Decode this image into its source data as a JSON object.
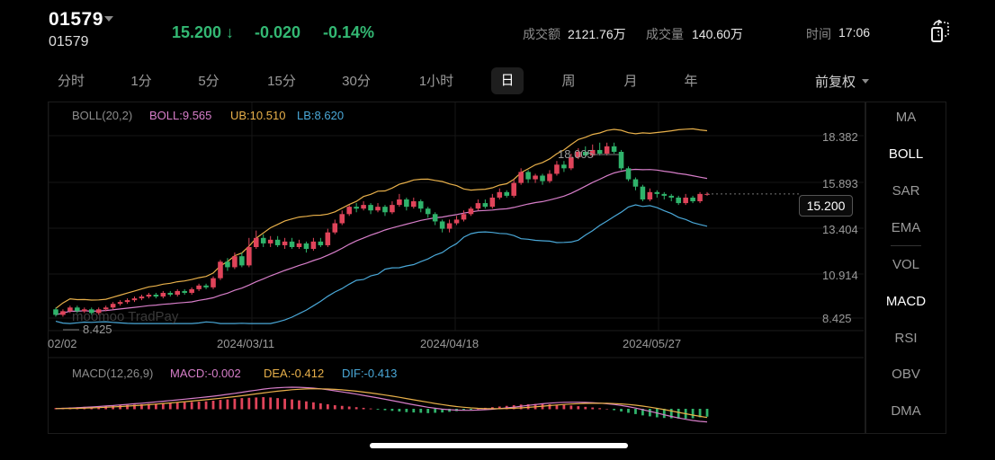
{
  "header": {
    "code": "01579",
    "code_sub": "01579",
    "price": "15.200 ↓",
    "change": "-0.020",
    "change_pct": "-0.14%",
    "turnover_label": "成交额",
    "turnover_value": "2121.76万",
    "volume_label": "成交量",
    "volume_value": "140.60万",
    "time_label": "时间",
    "time_value": "17:06"
  },
  "tabs": [
    "分时",
    "1分",
    "5分",
    "15分",
    "30分",
    "1小时",
    "日",
    "周",
    "月",
    "年"
  ],
  "active_tab": "日",
  "adjust_label": "前复权",
  "indicators": [
    "MA",
    "BOLL",
    "SAR",
    "EMA",
    "VOL",
    "MACD",
    "RSI",
    "OBV",
    "DMA"
  ],
  "active_indicators": [
    "BOLL",
    "MACD"
  ],
  "boll_legend": {
    "name": "BOLL(20,2)",
    "mid": "BOLL:9.565",
    "ub": "UB:10.510",
    "lb": "LB:8.620"
  },
  "macd_legend": {
    "name": "MACD(12,26,9)",
    "macd": "MACD:-0.002",
    "dea": "DEA:-0.412",
    "dif": "DIF:-0.413"
  },
  "current_price_tag": "15.200",
  "high_marker": "18.005",
  "low_marker": "8.425",
  "watermark": "moomoo  TradPay",
  "colors": {
    "up": "#e0445a",
    "down": "#2fb36b",
    "ub": "#e8b04a",
    "mid": "#d77ec9",
    "lb": "#4aa8d8",
    "green_text": "#33b873"
  },
  "chart_data": {
    "type": "candlestick",
    "y_axis_ticks": [
      "18.382",
      "15.893",
      "13.404",
      "10.914",
      "8.425"
    ],
    "y_range": [
      8.425,
      18.382
    ],
    "x_axis_labels": [
      "02/02",
      "2024/03/11",
      "2024/04/18",
      "2024/05/27"
    ],
    "candles": [
      [
        8.9,
        8.6,
        9.0,
        8.5
      ],
      [
        8.6,
        8.8,
        8.9,
        8.5
      ],
      [
        8.8,
        9.0,
        9.1,
        8.7
      ],
      [
        9.0,
        8.8,
        9.1,
        8.7
      ],
      [
        8.8,
        8.9,
        9.0,
        8.7
      ],
      [
        8.9,
        8.7,
        9.0,
        8.6
      ],
      [
        8.7,
        8.9,
        9.0,
        8.6
      ],
      [
        8.9,
        9.0,
        9.1,
        8.8
      ],
      [
        9.0,
        9.2,
        9.3,
        8.9
      ],
      [
        9.2,
        9.3,
        9.4,
        9.1
      ],
      [
        9.3,
        9.4,
        9.5,
        9.2
      ],
      [
        9.4,
        9.5,
        9.6,
        9.3
      ],
      [
        9.5,
        9.6,
        9.7,
        9.4
      ],
      [
        9.6,
        9.7,
        9.8,
        9.5
      ],
      [
        9.7,
        9.6,
        9.8,
        9.5
      ],
      [
        9.6,
        9.8,
        9.9,
        9.5
      ],
      [
        9.8,
        9.7,
        9.9,
        9.6
      ],
      [
        9.7,
        9.9,
        10.0,
        9.6
      ],
      [
        9.9,
        9.8,
        10.0,
        9.7
      ],
      [
        9.8,
        10.0,
        10.1,
        9.7
      ],
      [
        10.0,
        10.2,
        10.3,
        9.9
      ],
      [
        10.2,
        10.1,
        10.3,
        10.0
      ],
      [
        10.1,
        10.6,
        10.7,
        10.0
      ],
      [
        10.6,
        11.5,
        11.6,
        10.5
      ],
      [
        11.5,
        11.2,
        11.7,
        11.0
      ],
      [
        11.2,
        11.8,
        12.0,
        11.1
      ],
      [
        11.8,
        11.3,
        12.0,
        11.2
      ],
      [
        11.3,
        12.3,
        12.8,
        11.2
      ],
      [
        12.3,
        12.8,
        13.2,
        12.2
      ],
      [
        12.8,
        12.5,
        13.0,
        12.3
      ],
      [
        12.5,
        12.7,
        12.9,
        12.3
      ],
      [
        12.7,
        12.4,
        12.9,
        12.3
      ],
      [
        12.4,
        12.6,
        12.8,
        12.2
      ],
      [
        12.6,
        12.3,
        12.8,
        12.2
      ],
      [
        12.3,
        12.5,
        12.7,
        12.2
      ],
      [
        12.5,
        12.2,
        12.6,
        12.0
      ],
      [
        12.2,
        12.6,
        12.8,
        12.1
      ],
      [
        12.6,
        12.4,
        12.8,
        12.3
      ],
      [
        12.4,
        13.1,
        13.3,
        12.3
      ],
      [
        13.1,
        13.6,
        13.8,
        13.0
      ],
      [
        13.6,
        14.1,
        14.3,
        13.5
      ],
      [
        14.1,
        14.5,
        14.6,
        14.0
      ],
      [
        14.5,
        14.4,
        14.7,
        14.2
      ],
      [
        14.4,
        14.6,
        14.8,
        14.3
      ],
      [
        14.6,
        14.3,
        14.7,
        14.1
      ],
      [
        14.3,
        14.5,
        14.7,
        14.2
      ],
      [
        14.5,
        14.2,
        14.6,
        14.0
      ],
      [
        14.2,
        14.6,
        14.8,
        14.1
      ],
      [
        14.6,
        14.9,
        15.2,
        14.5
      ],
      [
        14.9,
        14.5,
        15.0,
        14.3
      ],
      [
        14.5,
        14.8,
        15.0,
        14.4
      ],
      [
        14.8,
        14.4,
        14.9,
        14.2
      ],
      [
        14.4,
        14.1,
        14.5,
        13.9
      ],
      [
        14.1,
        13.7,
        14.2,
        13.5
      ],
      [
        13.7,
        13.3,
        13.8,
        13.1
      ],
      [
        13.3,
        13.6,
        13.8,
        13.1
      ],
      [
        13.6,
        13.8,
        14.0,
        13.5
      ],
      [
        13.8,
        14.1,
        14.3,
        13.7
      ],
      [
        14.1,
        14.4,
        14.5,
        14.0
      ],
      [
        14.4,
        14.7,
        14.9,
        14.3
      ],
      [
        14.7,
        14.5,
        14.9,
        14.4
      ],
      [
        14.5,
        15.0,
        15.2,
        14.4
      ],
      [
        15.0,
        15.3,
        15.5,
        14.9
      ],
      [
        15.3,
        15.1,
        15.4,
        15.0
      ],
      [
        15.1,
        15.8,
        16.0,
        15.0
      ],
      [
        15.8,
        16.4,
        16.6,
        15.7
      ],
      [
        16.4,
        16.0,
        16.5,
        15.8
      ],
      [
        16.0,
        16.2,
        16.3,
        15.8
      ],
      [
        16.2,
        15.9,
        16.3,
        15.7
      ],
      [
        15.9,
        16.3,
        16.5,
        15.8
      ],
      [
        16.3,
        16.8,
        17.0,
        16.2
      ],
      [
        16.8,
        16.6,
        17.0,
        16.4
      ],
      [
        16.6,
        17.2,
        17.4,
        16.5
      ],
      [
        17.2,
        17.5,
        17.7,
        17.1
      ],
      [
        17.5,
        17.3,
        17.8,
        17.2
      ],
      [
        17.3,
        17.6,
        17.9,
        17.2
      ],
      [
        17.6,
        17.4,
        18.0,
        17.3
      ],
      [
        17.4,
        17.8,
        18.0,
        17.3
      ],
      [
        17.8,
        17.5,
        18.0,
        17.4
      ],
      [
        17.5,
        16.6,
        17.6,
        16.5
      ],
      [
        16.6,
        16.0,
        16.7,
        15.9
      ],
      [
        16.0,
        15.6,
        16.1,
        15.4
      ],
      [
        15.6,
        14.9,
        15.7,
        14.8
      ],
      [
        14.9,
        15.3,
        15.5,
        14.8
      ],
      [
        15.3,
        15.2,
        15.4,
        15.0
      ],
      [
        15.2,
        15.1,
        15.3,
        14.9
      ],
      [
        15.1,
        15.0,
        15.2,
        14.8
      ],
      [
        15.0,
        14.7,
        15.1,
        14.6
      ],
      [
        14.7,
        15.0,
        15.2,
        14.6
      ],
      [
        15.0,
        14.8,
        15.1,
        14.7
      ],
      [
        14.8,
        15.2,
        15.3,
        14.7
      ],
      [
        15.2,
        15.2,
        15.3,
        15.1
      ]
    ],
    "macd_hist": [
      0.05,
      0.06,
      0.08,
      0.1,
      0.12,
      0.14,
      0.16,
      0.18,
      0.2,
      0.22,
      0.24,
      0.26,
      0.28,
      0.3,
      0.32,
      0.34,
      0.36,
      0.38,
      0.4,
      0.42,
      0.44,
      0.46,
      0.5,
      0.55,
      0.58,
      0.62,
      0.66,
      0.68,
      0.7,
      0.72,
      0.7,
      0.66,
      0.62,
      0.58,
      0.52,
      0.46,
      0.4,
      0.34,
      0.28,
      0.22,
      0.18,
      0.14,
      0.1,
      0.06,
      0.02,
      -0.02,
      -0.06,
      -0.1,
      -0.14,
      -0.18,
      -0.2,
      -0.22,
      -0.24,
      -0.22,
      -0.2,
      -0.16,
      -0.12,
      -0.08,
      -0.04,
      0.02,
      0.06,
      0.1,
      0.14,
      0.18,
      0.22,
      0.26,
      0.28,
      0.3,
      0.3,
      0.28,
      0.26,
      0.24,
      0.2,
      0.16,
      0.12,
      0.08,
      0.04,
      0.0,
      -0.06,
      -0.14,
      -0.22,
      -0.3,
      -0.38,
      -0.44,
      -0.5,
      -0.54,
      -0.56,
      -0.58,
      -0.58,
      -0.56,
      -0.5,
      -0.46
    ]
  }
}
